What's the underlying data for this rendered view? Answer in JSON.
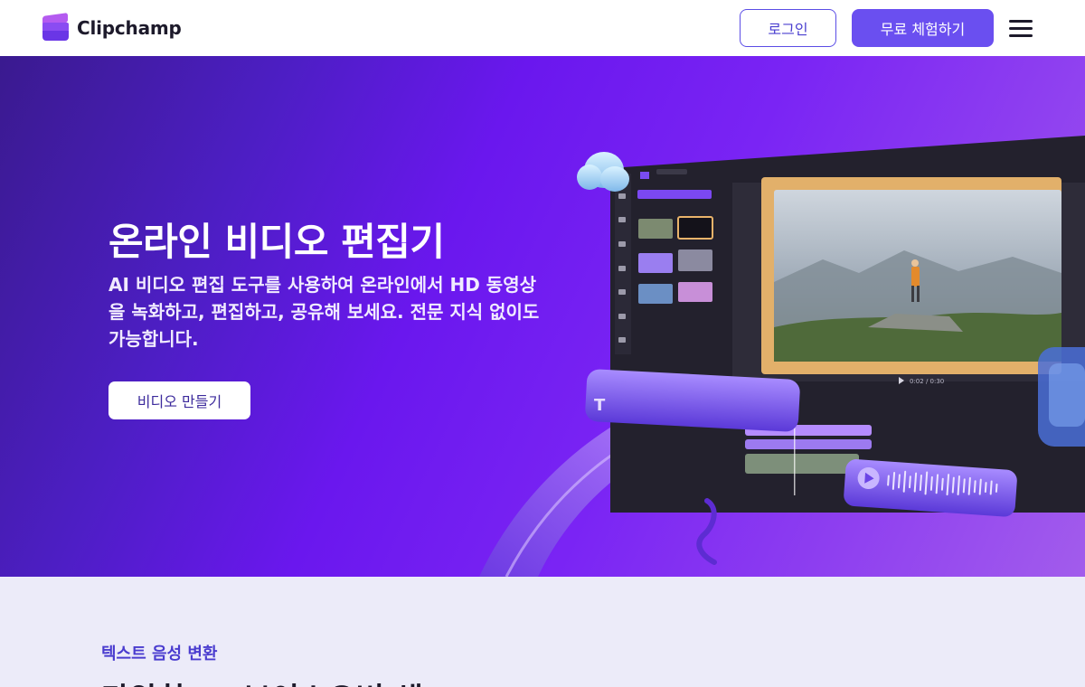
{
  "header": {
    "brand_name": "Clipchamp",
    "login_label": "로그인",
    "try_free_label": "무료 체험하기",
    "menu_icon": "hamburger-menu-icon"
  },
  "hero": {
    "title": "온라인 비디오 편집기",
    "subtitle": "AI 비디오 편집 도구를 사용하여 온라인에서 HD 동영상을 녹화하고, 편집하고, 공유해 보세요. 전문 지식 없이도 가능합니다.",
    "cta_label": "비디오 만들기",
    "illustration": {
      "timecode": "0:02 / 0:30"
    }
  },
  "feature": {
    "eyebrow": "텍스트 음성 변환",
    "heading": "다양한 AI 보이스오버 생"
  },
  "colors": {
    "accent": "#6a4ff0",
    "hero_gradient_start": "#3a1a8f",
    "hero_gradient_end": "#a25cec",
    "feature_bg": "#ecebf9",
    "eyebrow": "#4a3ccf"
  }
}
